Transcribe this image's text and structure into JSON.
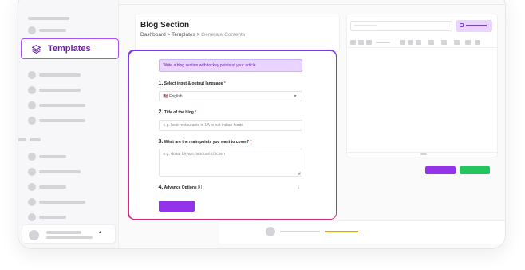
{
  "sidebar": {
    "active_item_label": "Templates",
    "active_item_icon": "layers-icon"
  },
  "header": {
    "title": "Blog Section",
    "breadcrumb": [
      "Dashboard",
      "Templates",
      "Generate Contents"
    ],
    "breadcrumb_separator": ">"
  },
  "form": {
    "hint": "Write a blog section with tockey points of your article",
    "q1": {
      "num": "1.",
      "label": "Select input & output language",
      "required": "*",
      "value": "🇺🇸 English"
    },
    "q2": {
      "num": "2.",
      "label": "Title of the blog",
      "required": "*",
      "placeholder": "e.g. best restaurants in LA to eat indian foods"
    },
    "q3": {
      "num": "3.",
      "label": "What are the main points you want to cover?",
      "required": "*",
      "placeholder": "e.g. dosa, biryani, tandoori chicken"
    },
    "q4": {
      "num": "4.",
      "label": "Advance Options ⓘ",
      "chevron": "↓"
    }
  },
  "colors": {
    "accent": "#9333ea",
    "accent_light": "#e9d5ff",
    "success": "#22c55e",
    "footer_progress": "#f59e0b"
  }
}
